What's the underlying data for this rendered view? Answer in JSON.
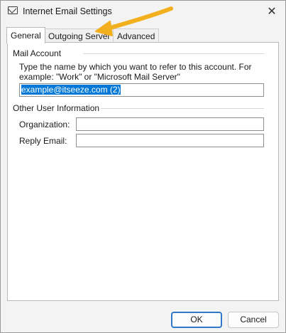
{
  "window": {
    "title": "Internet Email Settings",
    "close_symbol": "✕"
  },
  "tabs": [
    {
      "label": "General",
      "active": true
    },
    {
      "label": "Outgoing Server",
      "active": false
    },
    {
      "label": "Advanced",
      "active": false
    }
  ],
  "mail_account": {
    "section_title": "Mail Account",
    "description": "Type the name by which you want to refer to this account. For example: \"Work\" or \"Microsoft Mail Server\"",
    "account_name_value": "example@itseeze.com (2)"
  },
  "other_user_info": {
    "section_title": "Other User Information",
    "organization_label": "Organization:",
    "organization_value": "",
    "reply_email_label": "Reply Email:",
    "reply_email_value": ""
  },
  "buttons": {
    "ok_label": "OK",
    "cancel_label": "Cancel"
  },
  "annotation": {
    "arrow_color": "#f2b01e"
  },
  "colors": {
    "selection": "#0078d7",
    "default_button_border": "#3078c8"
  }
}
